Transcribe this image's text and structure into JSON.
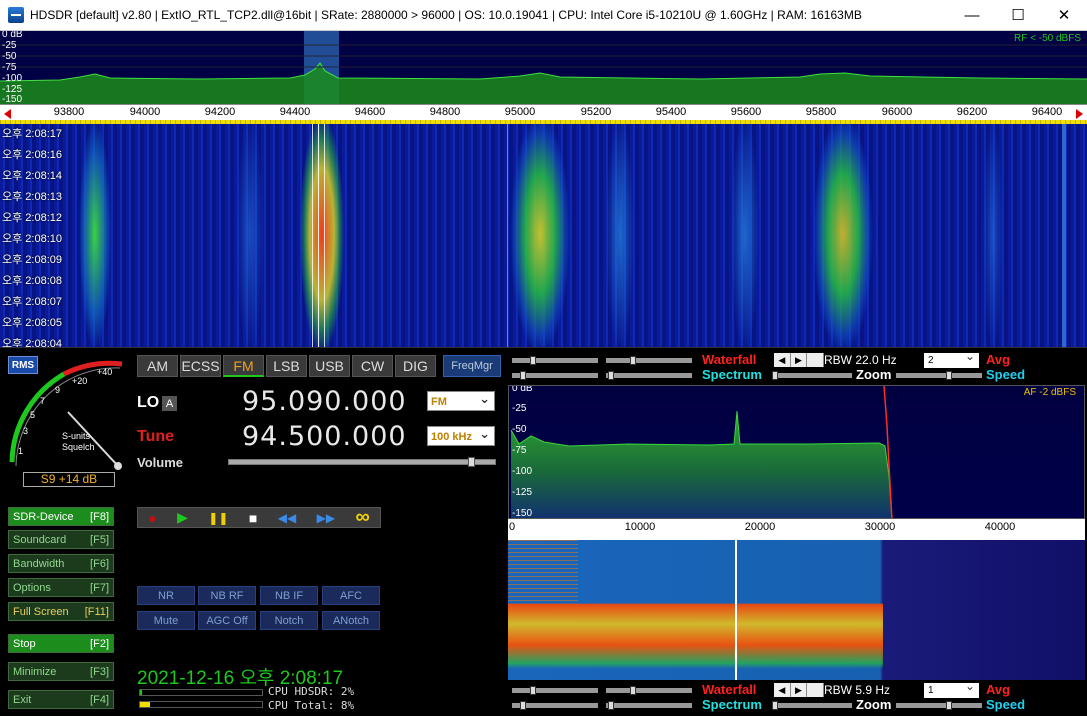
{
  "window": {
    "title": "HDSDR  [default]  v2.80   |  ExtIO_RTL_TCP2.dll@16bit  |  SRate: 2880000 > 96000  |  OS: 10.0.19041  |  CPU: Intel Core i5-10210U @ 1.60GHz  |  RAM: 16163MB",
    "minimize": "—",
    "maximize": "☐",
    "close": "✕"
  },
  "rf_spectrum": {
    "db_scale": [
      "0 dB",
      "-25",
      "-50",
      "-75",
      "-100",
      "-125",
      "-150"
    ],
    "rf_label": "RF < -50 dBFS"
  },
  "freq_axis": {
    "ticks": [
      "93800",
      "94000",
      "94200",
      "94400",
      "94600",
      "94800",
      "95000",
      "95200",
      "95400",
      "95600",
      "95800",
      "96000",
      "96200",
      "96400"
    ]
  },
  "waterfall": {
    "times": [
      "오후 2:08:17",
      "오후 2:08:16",
      "오후 2:08:14",
      "오후 2:08:13",
      "오후 2:08:12",
      "오후 2:08:10",
      "오후 2:08:09",
      "오후 2:08:08",
      "오후 2:08:07",
      "오후 2:08:05",
      "오후 2:08:04"
    ]
  },
  "meter": {
    "rms": "RMS",
    "scale": [
      "1",
      "3",
      "5",
      "7",
      "9",
      "+20",
      "+40"
    ],
    "sunits": "S-units",
    "squelch": "Squelch",
    "reading": "S9 +14 dB"
  },
  "modes": [
    "AM",
    "ECSS",
    "FM",
    "LSB",
    "USB",
    "CW",
    "DIG"
  ],
  "active_mode": "FM",
  "freqmgr": "FreqMgr",
  "lo": {
    "label": "LO",
    "badge": "A",
    "frequency": "95.090.000",
    "mode_dropdown": "FM"
  },
  "tune": {
    "label": "Tune",
    "frequency": "94.500.000",
    "step_dropdown": "100 kHz"
  },
  "volume": {
    "label": "Volume",
    "level": 0.9
  },
  "left_buttons": [
    {
      "label": "SDR-Device",
      "key": "[F8]"
    },
    {
      "label": "Soundcard",
      "key": "[F5]"
    },
    {
      "label": "Bandwidth",
      "key": "[F6]"
    },
    {
      "label": "Options",
      "key": "[F7]"
    },
    {
      "label": "Full Screen",
      "key": "[F11]"
    },
    {
      "label": "Stop",
      "key": "[F2]"
    },
    {
      "label": "Minimize",
      "key": "[F3]"
    },
    {
      "label": "Exit",
      "key": "[F4]"
    }
  ],
  "transport": {
    "record": "●",
    "play": "▶",
    "pause": "❚❚",
    "stop": "■",
    "rewind": "◀◀",
    "forward": "▶▶",
    "loop": "∞"
  },
  "dsp_buttons": [
    "NR",
    "NB RF",
    "NB IF",
    "AFC",
    "Mute",
    "AGC Off",
    "Notch",
    "ANotch"
  ],
  "status": {
    "datetime": "2021-12-16 오후 2:08:17",
    "cpu_hdsdr": "CPU HDSDR: 2%",
    "cpu_total": "CPU Total: 8%",
    "cpu_hdsdr_level": 0.02,
    "cpu_total_level": 0.08
  },
  "right_top": {
    "waterfall": "Waterfall",
    "spectrum": "Spectrum",
    "zoom": "Zoom",
    "speed": "Speed",
    "avg": "Avg",
    "nav_left": "◀",
    "nav_right": "▶",
    "rbw": "RBW  22.0 Hz",
    "avg_value": "2"
  },
  "af_spectrum": {
    "db_scale": [
      "0 dB",
      "-25",
      "-50",
      "-75",
      "-100",
      "-125",
      "-150"
    ],
    "af_label": "AF  -2 dBFS",
    "ticks": [
      "0",
      "10000",
      "20000",
      "30000",
      "40000"
    ]
  },
  "right_bottom": {
    "waterfall": "Waterfall",
    "spectrum": "Spectrum",
    "zoom": "Zoom",
    "speed": "Speed",
    "avg": "Avg",
    "nav_left": "◀",
    "nav_right": "▶",
    "rbw": "RBW  5.9 Hz",
    "avg_value": "1"
  },
  "colors": {
    "accent_green": "#1ec81e",
    "tune_red": "#e02020",
    "waterfall_red": "#ff2020",
    "spectrum_cyan": "#20e0e0",
    "speed_cyan": "#20d0f0",
    "avg_red": "#ff2020"
  }
}
